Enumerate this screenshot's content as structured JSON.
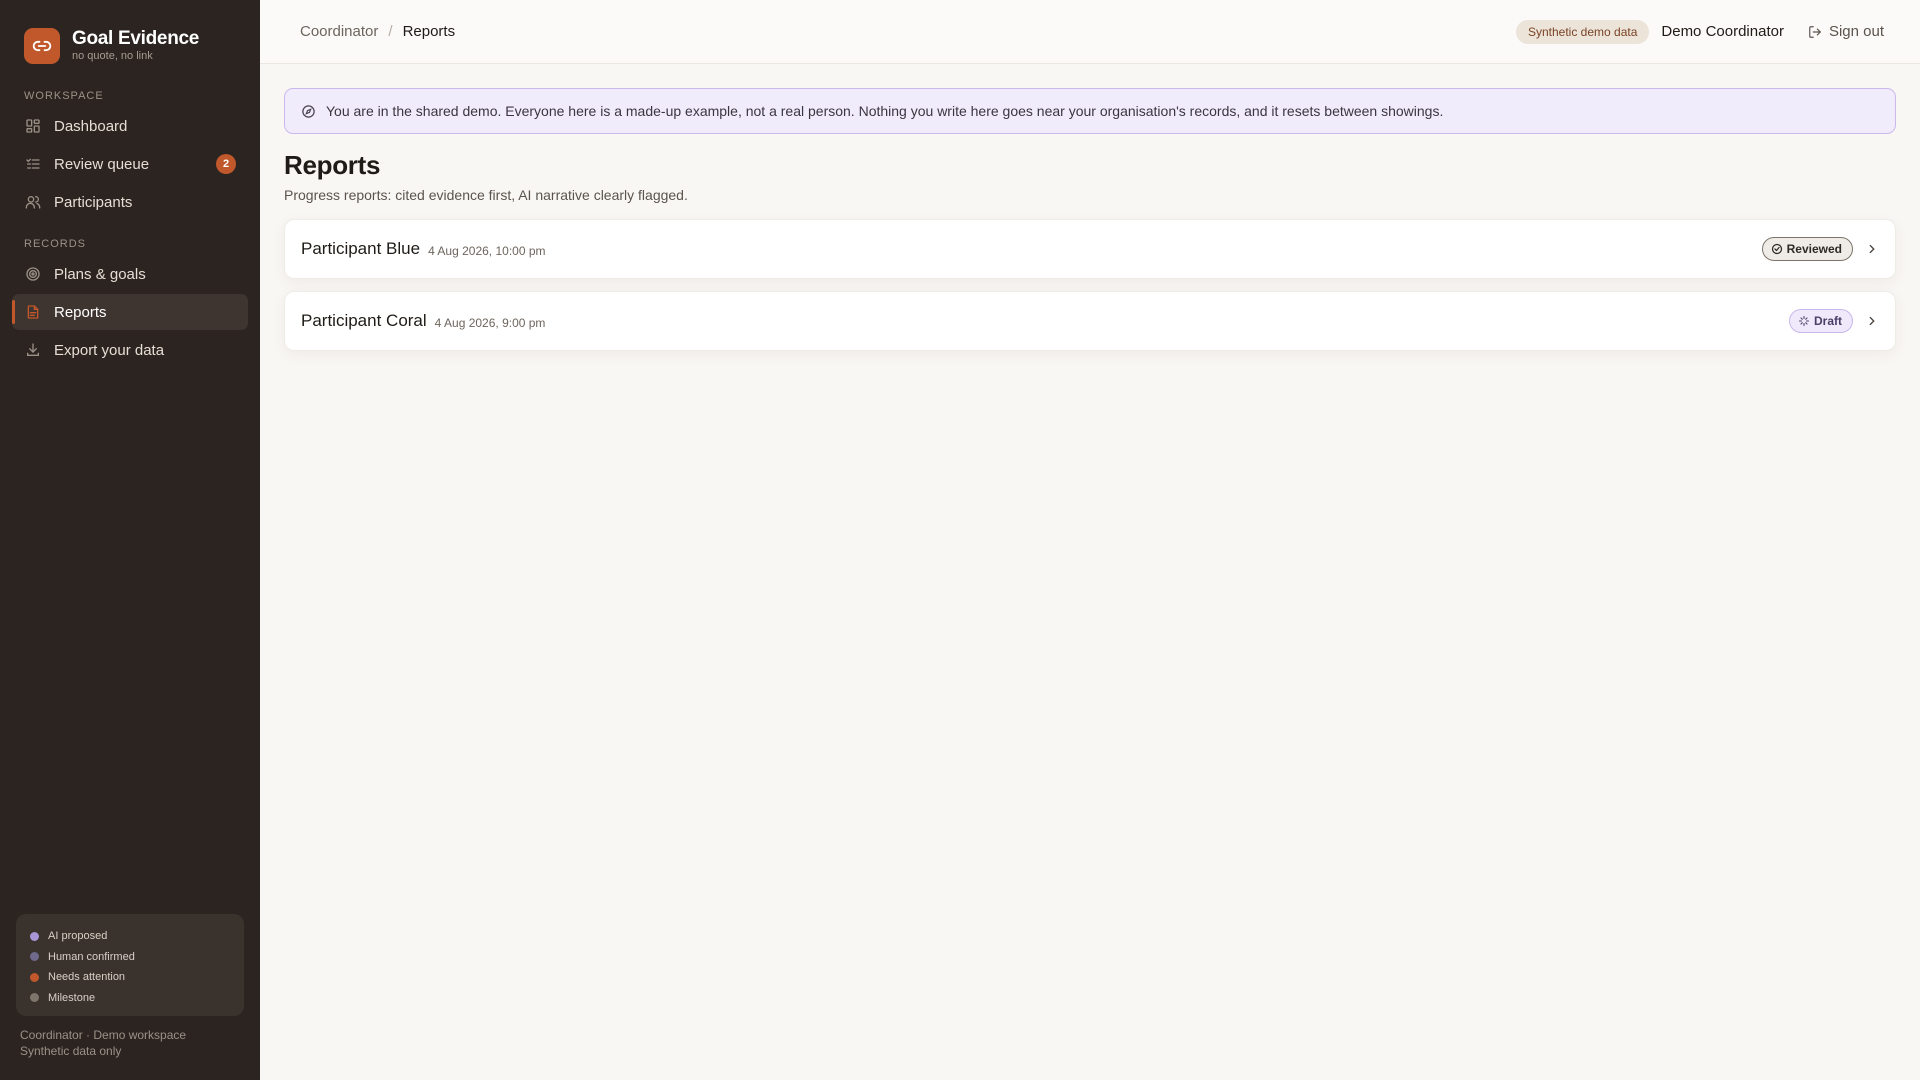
{
  "brand": {
    "title": "Goal Evidence",
    "subtitle": "no quote, no link"
  },
  "sidebar": {
    "sections": [
      {
        "label": "WORKSPACE",
        "items": [
          {
            "label": "Dashboard",
            "icon": "grid-icon"
          },
          {
            "label": "Review queue",
            "icon": "list-check-icon",
            "badge": "2"
          },
          {
            "label": "Participants",
            "icon": "users-icon"
          }
        ]
      },
      {
        "label": "RECORDS",
        "items": [
          {
            "label": "Plans & goals",
            "icon": "target-icon"
          },
          {
            "label": "Reports",
            "icon": "document-icon",
            "active": true
          },
          {
            "label": "Export your data",
            "icon": "download-icon"
          }
        ]
      }
    ],
    "legend": [
      {
        "label": "AI proposed",
        "color": "#a996d6"
      },
      {
        "label": "Human confirmed",
        "color": "#6f6a8c"
      },
      {
        "label": "Needs attention",
        "color": "#c0582b"
      },
      {
        "label": "Milestone",
        "color": "#7e756c"
      }
    ],
    "footer": {
      "line1": "Coordinator · Demo workspace",
      "line2": "Synthetic data only"
    }
  },
  "topbar": {
    "breadcrumb": {
      "parent": "Coordinator",
      "separator": "/",
      "current": "Reports"
    },
    "demo_pill": "Synthetic demo data",
    "user_name": "Demo Coordinator",
    "signout_label": "Sign out"
  },
  "notice": {
    "text": "You are in the shared demo. Everyone here is a made-up example, not a real person. Nothing you write here goes near your organisation's records, and it resets between showings."
  },
  "page": {
    "title": "Reports",
    "subtitle": "Progress reports: cited evidence first, AI narrative clearly flagged."
  },
  "reports": [
    {
      "name": "Participant Blue",
      "date": "4 Aug 2026, 10:00 pm",
      "status": "Reviewed"
    },
    {
      "name": "Participant Coral",
      "date": "4 Aug 2026, 9:00 pm",
      "status": "Draft"
    }
  ],
  "colors": {
    "accent": "#c0582b",
    "sidebar_bg": "#2b2420",
    "notice_bg": "#f1ecfb",
    "notice_border": "#c9b9ee"
  }
}
